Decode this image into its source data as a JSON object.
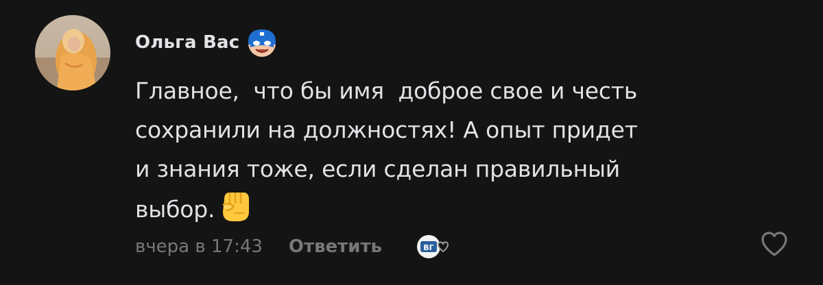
{
  "comment": {
    "author_name": "Ольга Вас",
    "author_badge_icon": "superhero-mask-emoji-icon",
    "text_lines": [
      "Главное,  что бы имя  доброе свое и честь",
      "сохранили на должностях! А опыт придет",
      "и знания тоже, если сделан правильный",
      "выбор."
    ],
    "text_emoji_icon": "raised-fist-emoji-icon",
    "timestamp": "вчера в 17:43",
    "reply_label": "Ответить",
    "author_like_badge_text": "ВГ",
    "author_like_badge_icon": "author-liked-heart-icon",
    "like_icon": "heart-outline-icon"
  },
  "colors": {
    "background": "#141414",
    "text_primary": "#e1e3e6",
    "text_secondary": "#76787a",
    "emoji_yellow": "#ffc83d"
  }
}
